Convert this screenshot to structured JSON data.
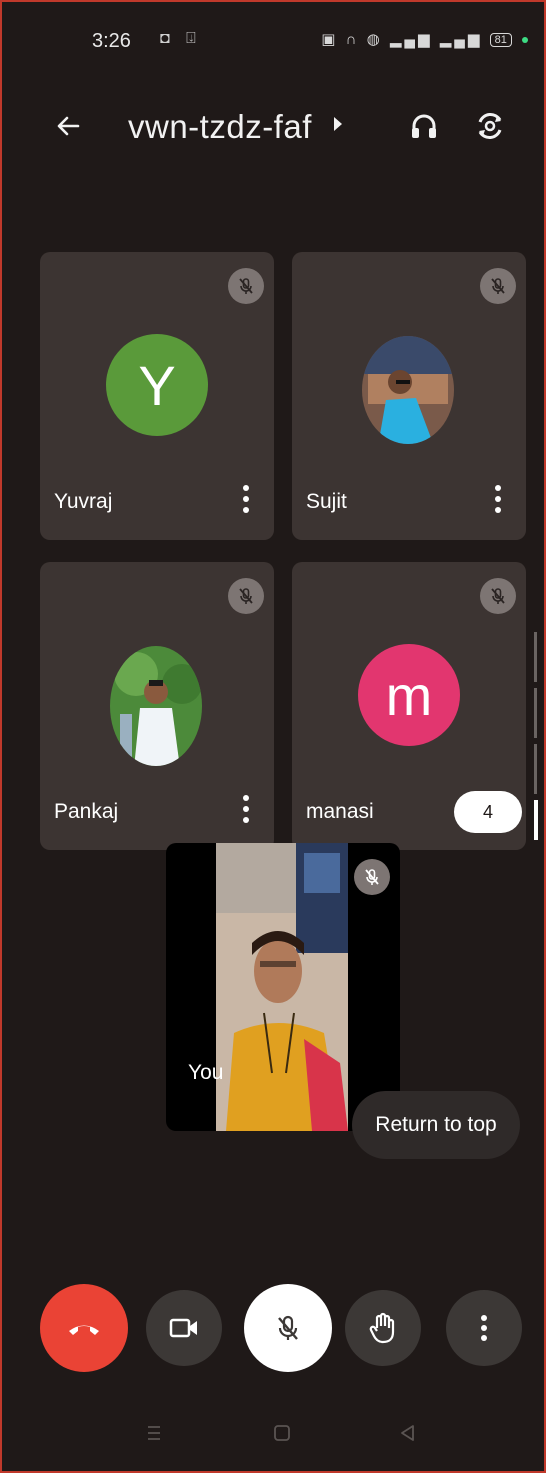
{
  "status_bar": {
    "time": "3:26",
    "battery": "81"
  },
  "header": {
    "meeting_code": "vwn-tzdz-faf"
  },
  "participants": [
    {
      "name": "Yuvraj",
      "avatar_letter": "Y",
      "avatar_color": "#5a9a3a",
      "muted": true
    },
    {
      "name": "Sujit",
      "avatar_type": "photo",
      "muted": true
    },
    {
      "name": "Pankaj",
      "avatar_type": "photo",
      "muted": true
    },
    {
      "name": "manasi",
      "avatar_letter": "m",
      "avatar_color": "#e2366f",
      "muted": true
    }
  ],
  "page_count": "4",
  "self_view": {
    "label": "You",
    "muted": true
  },
  "return_to_top": "Return to top",
  "controls": {
    "end_call_color": "#ea4335",
    "camera_icon": "video-camera-icon",
    "mic_icon": "mic-off-icon",
    "raise_hand_icon": "hand-icon",
    "more_icon": "more-vertical-icon"
  },
  "colors": {
    "background": "#1f1918",
    "tile": "#3c3432",
    "accent_border": "#c0392b"
  }
}
